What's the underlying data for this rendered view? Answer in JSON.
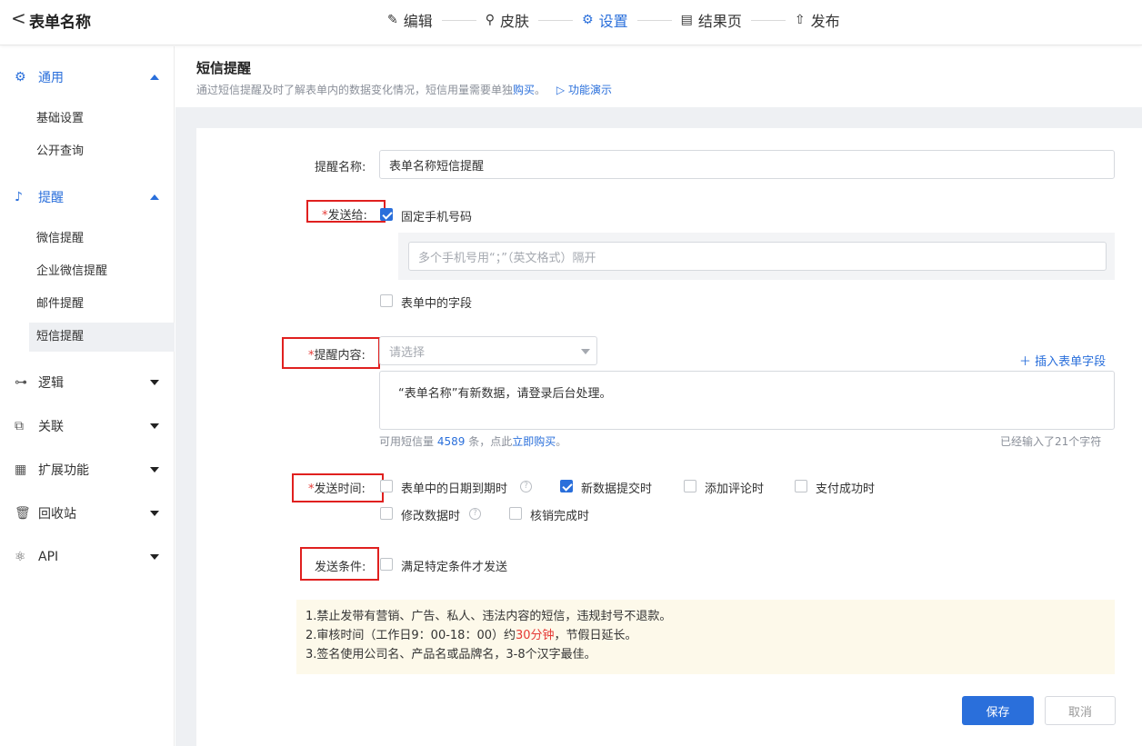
{
  "topbar": {
    "back_glyph": "<",
    "form_title": "表单名称",
    "steps": [
      {
        "label": "编辑",
        "icon": "edit-icon",
        "glyph": "✎"
      },
      {
        "label": "皮肤",
        "icon": "brush-icon",
        "glyph": "⚲"
      },
      {
        "label": "设置",
        "icon": "gear-icon",
        "glyph": "⚙"
      },
      {
        "label": "结果页",
        "icon": "document-icon",
        "glyph": "▤"
      },
      {
        "label": "发布",
        "icon": "publish-icon",
        "glyph": "⇧"
      }
    ],
    "active_step": "设置"
  },
  "sidebar": {
    "groups": [
      {
        "label": "通用",
        "icon": "gear-icon",
        "glyph": "⚙",
        "open": true,
        "items": [
          "基础设置",
          "公开查询"
        ]
      },
      {
        "label": "提醒",
        "icon": "bell-icon",
        "glyph": "♪",
        "open": true,
        "items": [
          "微信提醒",
          "企业微信提醒",
          "邮件提醒",
          "短信提醒"
        ]
      },
      {
        "label": "逻辑",
        "icon": "logic-icon",
        "glyph": "⊶",
        "open": false
      },
      {
        "label": "关联",
        "icon": "link-icon",
        "glyph": "⧉",
        "open": false
      },
      {
        "label": "扩展功能",
        "icon": "grid-icon",
        "glyph": "▦",
        "open": false
      },
      {
        "label": "回收站",
        "icon": "trash-icon",
        "glyph": "🗑",
        "open": false
      },
      {
        "label": "API",
        "icon": "api-icon",
        "glyph": "⚛",
        "open": false
      }
    ],
    "active_item": "短信提醒"
  },
  "header": {
    "title": "短信提醒",
    "desc_prefix": "通过短信提醒及时了解表单内的数据变化情况，短信用量需要单独",
    "desc_link": "购买",
    "desc_suffix": "。",
    "demo_icon": "play-icon",
    "demo_link": "功能演示"
  },
  "form": {
    "name_label": "提醒名称:",
    "name_value": "表单名称短信提醒",
    "send_to_label": "发送给:",
    "fixed_phone_label": "固定手机号码",
    "fixed_phone_checked": true,
    "phone_placeholder": "多个手机号用“；”（英文格式）隔开",
    "form_field_label": "表单中的字段",
    "form_field_checked": false,
    "content_label": "提醒内容:",
    "content_select_placeholder": "请选择",
    "insert_field_link": "插入表单字段",
    "content_text": "“表单名称”有新数据，请登录后台处理。",
    "sms_prefix": "可用短信量",
    "sms_count": "4589",
    "sms_mid": "条，点此",
    "sms_buy_link": "立即购买",
    "sms_end": "。",
    "char_count_text": "已经输入了21个字符",
    "send_time_label": "发送时间:",
    "time_options": [
      {
        "label": "表单中的日期到期时",
        "checked": false,
        "help": true
      },
      {
        "label": "新数据提交时",
        "checked": true,
        "help": false
      },
      {
        "label": "添加评论时",
        "checked": false,
        "help": false
      },
      {
        "label": "支付成功时",
        "checked": false,
        "help": false
      },
      {
        "label": "修改数据时",
        "checked": false,
        "help": true
      },
      {
        "label": "核销完成时",
        "checked": false,
        "help": false
      }
    ],
    "condition_label": "发送条件:",
    "condition_option": "满足特定条件才发送",
    "condition_checked": false
  },
  "notice": {
    "line1": "1.禁止发带有营销、广告、私人、违法内容的短信，违规封号不退款。",
    "line2_prefix": "2.审核时间（工作日9：00-18：00）约",
    "line2_highlight": "30分钟",
    "line2_suffix": "，节假日延长。",
    "line3": "3.签名使用公司名、产品名或品牌名，3-8个汉字最佳。"
  },
  "buttons": {
    "save": "保存",
    "cancel": "取消"
  },
  "colors": {
    "accent": "#2a6fdb",
    "required": "#e53935",
    "highlight_box": "#e0201f",
    "notice_bg": "#fdf9ea"
  }
}
